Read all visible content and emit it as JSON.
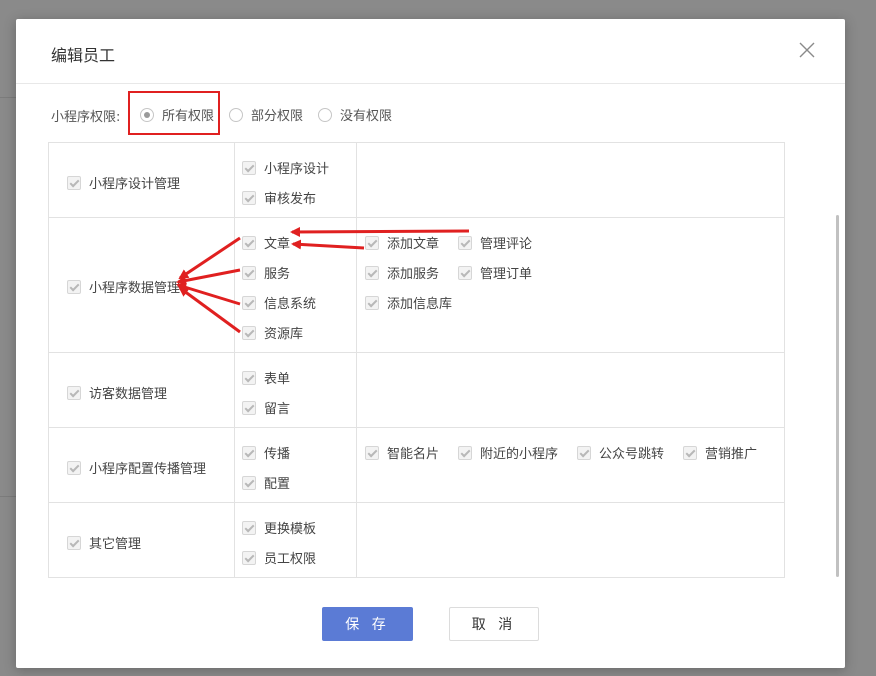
{
  "dialog": {
    "title": "编辑员工"
  },
  "permission": {
    "label": "小程序权限:",
    "options": [
      {
        "label": "所有权限",
        "checked": true
      },
      {
        "label": "部分权限",
        "checked": false
      },
      {
        "label": "没有权限",
        "checked": false
      }
    ]
  },
  "modules": [
    {
      "name": "小程序设计管理",
      "subs": [
        "小程序设计",
        "审核发布"
      ],
      "actions": []
    },
    {
      "name": "小程序数据管理",
      "subs": [
        "文章",
        "服务",
        "信息系统",
        "资源库"
      ],
      "actions": [
        "添加文章",
        "管理评论",
        "添加服务",
        "管理订单",
        "添加信息库"
      ]
    },
    {
      "name": "访客数据管理",
      "subs": [
        "表单",
        "留言"
      ],
      "actions": []
    },
    {
      "name": "小程序配置传播管理",
      "subs": [
        "传播",
        "配置"
      ],
      "actions": [
        "智能名片",
        "附近的小程序",
        "公众号跳转",
        "营销推广"
      ]
    },
    {
      "name": "其它管理",
      "subs": [
        "更换模板",
        "员工权限"
      ],
      "actions": []
    }
  ],
  "buttons": {
    "save": "保 存",
    "cancel": "取 消"
  },
  "annotation_color": "#e02020",
  "icons": {
    "close": "close-icon",
    "check": "checkbox-check-icon",
    "radio": "radio-dot-icon"
  }
}
